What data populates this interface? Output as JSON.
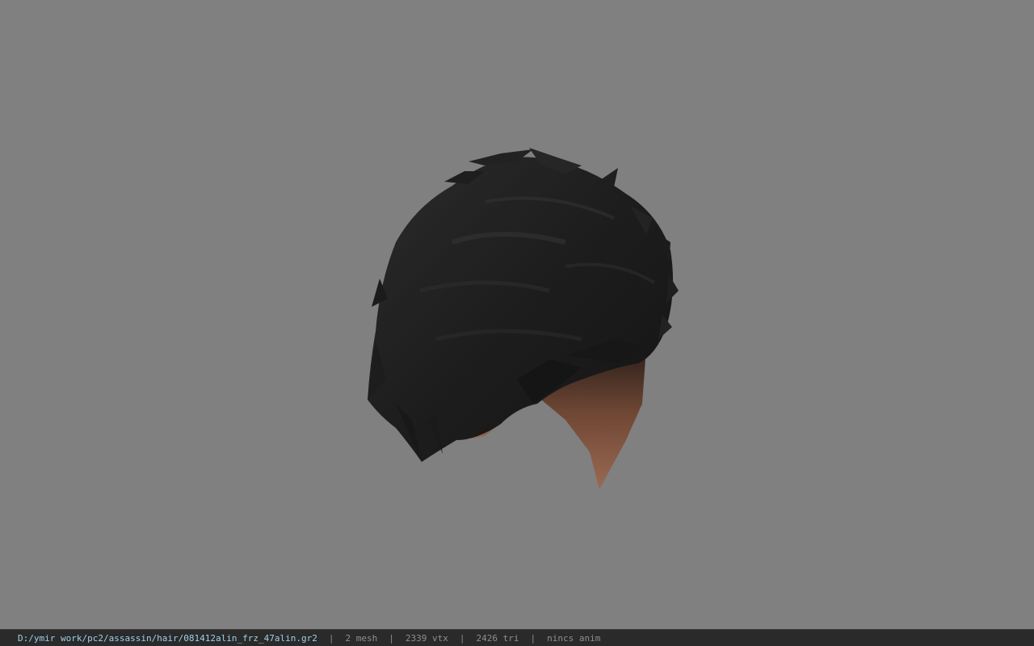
{
  "viewport": {
    "background": "#808080",
    "model": {
      "description_icon": "hair-mesh-model",
      "hair_color": "#1c1c1c",
      "skin_color": "#8a5a44"
    }
  },
  "statusbar": {
    "path": "D:/ymir work/pc2/assassin/hair/081412alin_frz_47alin.gr2",
    "separator": "|",
    "mesh": "2 mesh",
    "vtx": "2339 vtx",
    "tri": "2426 tri",
    "anim": "nincs anim",
    "path_color": "#9fd0e6"
  }
}
